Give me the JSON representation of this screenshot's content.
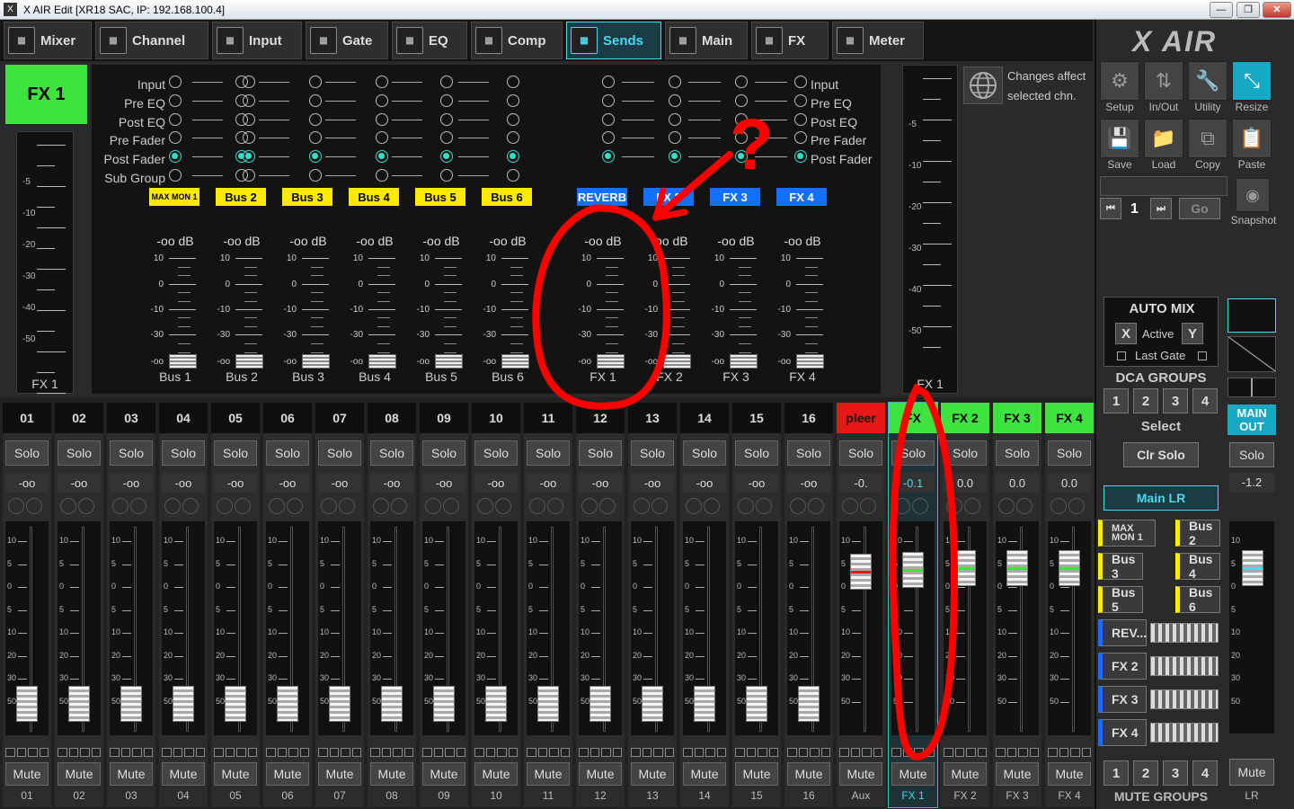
{
  "window": {
    "title": "X AIR Edit [XR18 SAC, IP: 192.168.100.4]",
    "min": "—",
    "max": "❐",
    "close": "✕"
  },
  "tabs": [
    {
      "label": "Mixer",
      "icon": "mixer-icon"
    },
    {
      "label": "Channel",
      "icon": "channel-icon"
    },
    {
      "label": "Input",
      "icon": "input-icon"
    },
    {
      "label": "Gate",
      "icon": "gate-icon"
    },
    {
      "label": "EQ",
      "icon": "eq-icon"
    },
    {
      "label": "Comp",
      "icon": "comp-icon"
    },
    {
      "label": "Sends",
      "icon": "sends-icon"
    },
    {
      "label": "Main",
      "icon": "main-icon"
    },
    {
      "label": "FX",
      "icon": "fx-icon"
    },
    {
      "label": "Meter",
      "icon": "meter-icon"
    }
  ],
  "active_tab": "Sends",
  "channel": {
    "name": "FX 1",
    "scale_label": "FX 1"
  },
  "left_scale": [
    "-5",
    "-10",
    "-20",
    "-30",
    "-40",
    "-50"
  ],
  "right_scale": [
    "-5",
    "-10",
    "-20",
    "-30",
    "-40",
    "-50"
  ],
  "right_scale_label": "FX 1",
  "tap_points_left": [
    "Input",
    "Pre EQ",
    "Post EQ",
    "Pre Fader",
    "Post Fader",
    "Sub Group"
  ],
  "tap_points_right": [
    "Input",
    "Pre EQ",
    "Post EQ",
    "Pre Fader",
    "Post Fader"
  ],
  "sends": [
    {
      "badge": "MAX MON 1",
      "badge_color": "#ffea00",
      "db": "-oo dB",
      "name": "Bus 1"
    },
    {
      "badge": "Bus 2",
      "badge_color": "#ffea00",
      "db": "-oo dB",
      "name": "Bus 2"
    },
    {
      "badge": "Bus 3",
      "badge_color": "#ffea00",
      "db": "-oo dB",
      "name": "Bus 3"
    },
    {
      "badge": "Bus 4",
      "badge_color": "#ffea00",
      "db": "-oo dB",
      "name": "Bus 4"
    },
    {
      "badge": "Bus 5",
      "badge_color": "#ffea00",
      "db": "-oo dB",
      "name": "Bus 5"
    },
    {
      "badge": "Bus 6",
      "badge_color": "#ffea00",
      "db": "-oo dB",
      "name": "Bus 6"
    },
    {
      "badge": "REVERB",
      "badge_color": "#1170ff",
      "db": "-oo dB",
      "name": "FX 1"
    },
    {
      "badge": "FX 2",
      "badge_color": "#1170ff",
      "db": "-oo dB",
      "name": "FX 2"
    },
    {
      "badge": "FX 3",
      "badge_color": "#1170ff",
      "db": "-oo dB",
      "name": "FX 3"
    },
    {
      "badge": "FX 4",
      "badge_color": "#1170ff",
      "db": "-oo dB",
      "name": "FX 4"
    }
  ],
  "send_scale": [
    "10",
    "0",
    "-10",
    "-30",
    "-oo"
  ],
  "changes_note": "Changes affect selected chn.",
  "toolbar": [
    {
      "label": "Setup",
      "icon": "gear-icon",
      "glyph": "⚙"
    },
    {
      "label": "In/Out",
      "icon": "inout-arrows-icon",
      "glyph": "⇅"
    },
    {
      "label": "Utility",
      "icon": "wrench-icon",
      "glyph": "🔧"
    },
    {
      "label": "Resize",
      "icon": "resize-icon",
      "glyph": "⤡"
    },
    {
      "label": "Save",
      "icon": "save-icon",
      "glyph": "💾"
    },
    {
      "label": "Load",
      "icon": "folder-icon",
      "glyph": "📁"
    },
    {
      "label": "Copy",
      "icon": "copy-icon",
      "glyph": "⧉"
    },
    {
      "label": "Paste",
      "icon": "paste-icon",
      "glyph": "📋"
    }
  ],
  "snapshot": {
    "number": "1",
    "go": "Go",
    "label": "Snapshot",
    "prev": "⏮",
    "next": "⏭"
  },
  "automix": {
    "title": "AUTO MIX",
    "x": "X",
    "active": "Active",
    "y": "Y",
    "last_gate": "Last Gate"
  },
  "dca": {
    "title": "DCA GROUPS",
    "buttons": [
      "1",
      "2",
      "3",
      "4"
    ],
    "select": "Select",
    "clr_solo": "Clr Solo"
  },
  "main_lr": "Main LR",
  "main_out": "MAIN OUT",
  "bus_buttons": [
    {
      "label": "MAX MON 1",
      "color": "yellow"
    },
    {
      "label": "Bus 2",
      "color": "yellow"
    },
    {
      "label": "Bus 3",
      "color": "yellow"
    },
    {
      "label": "Bus 4",
      "color": "yellow"
    },
    {
      "label": "Bus 5",
      "color": "yellow"
    },
    {
      "label": "Bus 6",
      "color": "yellow"
    },
    {
      "label": "REV...",
      "color": "blue"
    },
    {
      "label": "FX 2",
      "color": "blue"
    },
    {
      "label": "FX 3",
      "color": "blue"
    },
    {
      "label": "FX 4",
      "color": "blue"
    }
  ],
  "mute_groups": {
    "title": "MUTE GROUPS",
    "buttons": [
      "1",
      "2",
      "3",
      "4"
    ]
  },
  "strip_scale": [
    "10",
    "5",
    "0",
    "5",
    "10",
    "20",
    "30",
    "50"
  ],
  "strips": [
    {
      "num": "01",
      "level": "-oo",
      "bottom": "01",
      "fader": 0.92
    },
    {
      "num": "02",
      "level": "-oo",
      "bottom": "02",
      "fader": 0.92
    },
    {
      "num": "03",
      "level": "-oo",
      "bottom": "03",
      "fader": 0.92
    },
    {
      "num": "04",
      "level": "-oo",
      "bottom": "04",
      "fader": 0.92
    },
    {
      "num": "05",
      "level": "-oo",
      "bottom": "05",
      "fader": 0.92
    },
    {
      "num": "06",
      "level": "-oo",
      "bottom": "06",
      "fader": 0.92
    },
    {
      "num": "07",
      "level": "-oo",
      "bottom": "07",
      "fader": 0.92
    },
    {
      "num": "08",
      "level": "-oo",
      "bottom": "08",
      "fader": 0.92
    },
    {
      "num": "09",
      "level": "-oo",
      "bottom": "09",
      "fader": 0.92
    },
    {
      "num": "10",
      "level": "-oo",
      "bottom": "10",
      "fader": 0.92
    },
    {
      "num": "11",
      "level": "-oo",
      "bottom": "11",
      "fader": 0.92
    },
    {
      "num": "12",
      "level": "-oo",
      "bottom": "12",
      "fader": 0.92
    },
    {
      "num": "13",
      "level": "-oo",
      "bottom": "13",
      "fader": 0.92
    },
    {
      "num": "14",
      "level": "-oo",
      "bottom": "14",
      "fader": 0.92
    },
    {
      "num": "15",
      "level": "-oo",
      "bottom": "15",
      "fader": 0.92
    },
    {
      "num": "16",
      "level": "-oo",
      "bottom": "16",
      "fader": 0.92
    },
    {
      "num": "pleer",
      "level": "-0.",
      "bottom": "Aux",
      "fader": 0.22,
      "color": "#e81818",
      "mark": "#e81818"
    },
    {
      "num": "FX",
      "level": "-0.1",
      "bottom": "FX 1",
      "fader": 0.21,
      "color": "#3fe33f",
      "mark": "#3fe33f",
      "selected": true
    },
    {
      "num": "FX 2",
      "level": "0.0",
      "bottom": "FX 2",
      "fader": 0.2,
      "color": "#3fe33f",
      "mark": "#3fe33f"
    },
    {
      "num": "FX 3",
      "level": "0.0",
      "bottom": "FX 3",
      "fader": 0.2,
      "color": "#3fe33f",
      "mark": "#3fe33f"
    },
    {
      "num": "FX 4",
      "level": "0.0",
      "bottom": "FX 4",
      "fader": 0.2,
      "color": "#3fe33f",
      "mark": "#3fe33f"
    }
  ],
  "main_strip": {
    "solo": "Solo",
    "level": "-1.2",
    "mute": "Mute",
    "bottom": "LR",
    "fader": 0.2
  },
  "solo_label": "Solo",
  "mute_label": "Mute",
  "annotation": {
    "color": "#ff0000",
    "question": "?"
  }
}
